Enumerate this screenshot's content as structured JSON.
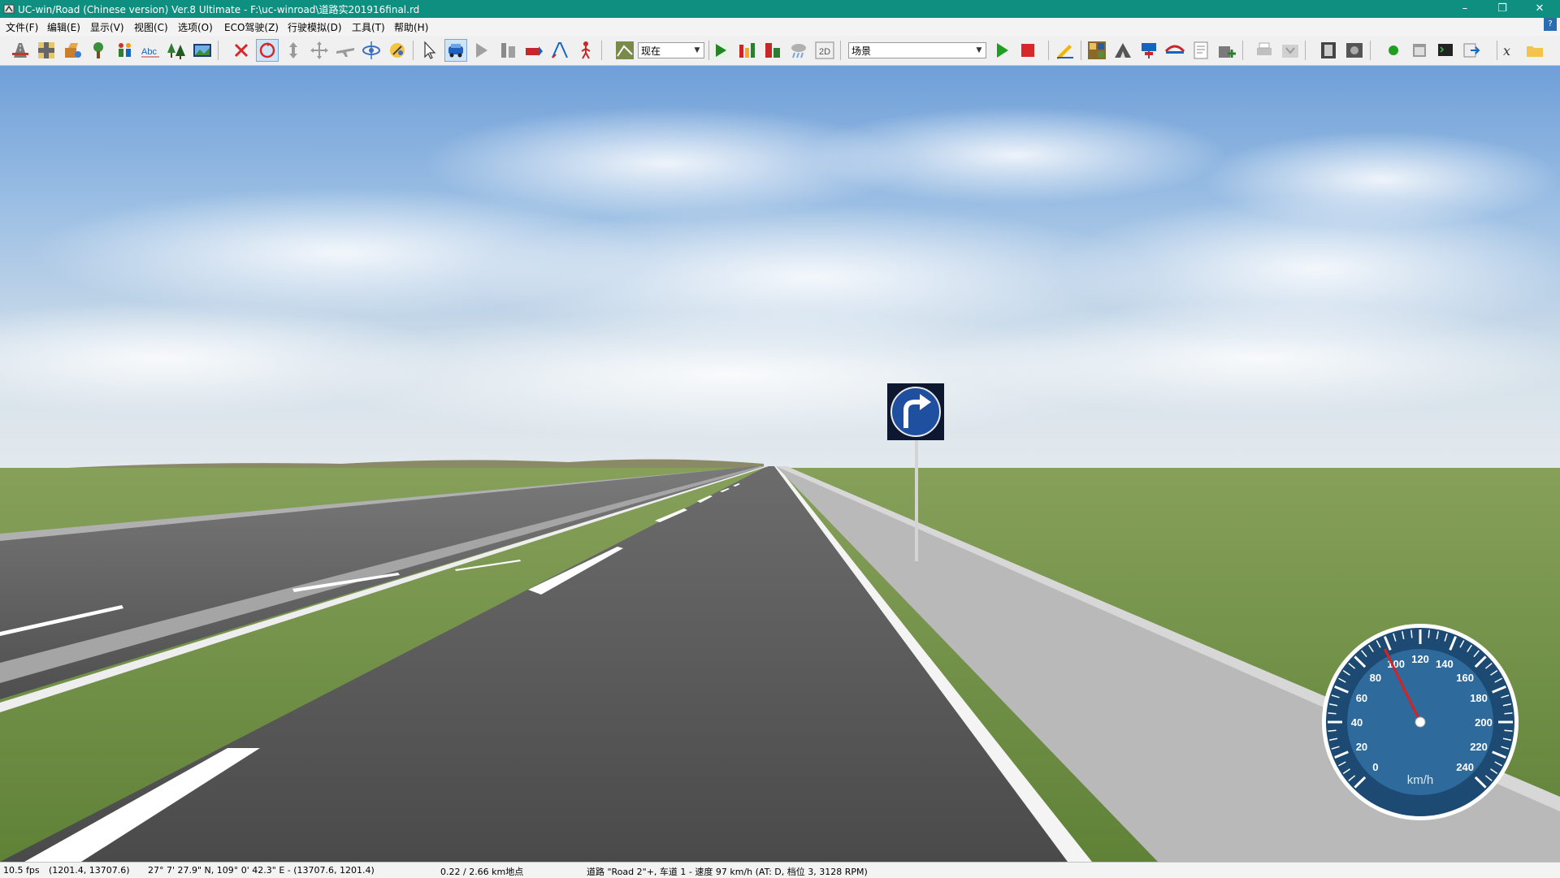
{
  "window": {
    "title": "UC-win/Road (Chinese version) Ver.8 Ultimate - F:\\uc-winroad\\道路实201916final.rd",
    "accent": "#0f8f80"
  },
  "menu": [
    "文件(F)",
    "编辑(E)",
    "显示(V)",
    "视图(C)",
    "选项(O)",
    "ECO驾驶(Z)",
    "行驶模拟(D)",
    "工具(T)",
    "帮助(H)"
  ],
  "toolbar": {
    "time_combo": "现在",
    "scenario_combo": "场景",
    "icon_2d": "2D"
  },
  "speedometer": {
    "unit": "km/h",
    "ticks": [
      "0",
      "20",
      "40",
      "60",
      "80",
      "100",
      "120",
      "140",
      "160",
      "180",
      "200",
      "220",
      "240"
    ],
    "current_speed": 97
  },
  "status": {
    "fps": "10.5 fps",
    "xy": "(1201.4, 13707.6)",
    "geo": "27°  7' 27.9\" N, 109°  0' 42.3\" E  -  (13707.6, 1201.4)",
    "distance": "0.22 / 2.66 km地点",
    "road_info": "道路 \"Road 2\"+, 车道 1 - 速度 97 km/h (AT: D, 档位 3, 3128 RPM)"
  }
}
